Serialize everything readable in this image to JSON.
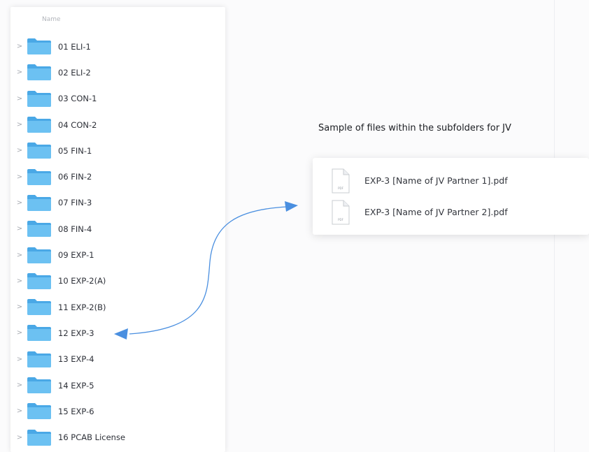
{
  "finder": {
    "column_header": "Name",
    "folders": [
      {
        "label": "01 ELI-1"
      },
      {
        "label": "02 ELI-2"
      },
      {
        "label": "03 CON-1"
      },
      {
        "label": "04 CON-2"
      },
      {
        "label": "05 FIN-1"
      },
      {
        "label": "06 FIN-2"
      },
      {
        "label": "07 FIN-3"
      },
      {
        "label": "08 FIN-4"
      },
      {
        "label": "09 EXP-1"
      },
      {
        "label": "10 EXP-2(A)"
      },
      {
        "label": "11 EXP-2(B)"
      },
      {
        "label": "12 EXP-3"
      },
      {
        "label": "13 EXP-4"
      },
      {
        "label": "14 EXP-5"
      },
      {
        "label": "15 EXP-6"
      },
      {
        "label": "16 PCAB License"
      }
    ],
    "chevron_icon": "chevron-right-icon",
    "folder_icon": "folder-icon",
    "folder_color": "#5fb9ee"
  },
  "sample": {
    "title": "Sample of files within the subfolders for JV",
    "files": [
      {
        "label": "EXP-3 [Name of JV Partner 1].pdf",
        "icon_text": "PDF"
      },
      {
        "label": "EXP-3 [Name of JV Partner 2].pdf",
        "icon_text": "PDF"
      }
    ],
    "file_icon": "pdf-document-icon"
  },
  "annotation": {
    "arrow_color": "#4a8fe0",
    "arrow_icon": "double-headed-arrow-icon"
  }
}
